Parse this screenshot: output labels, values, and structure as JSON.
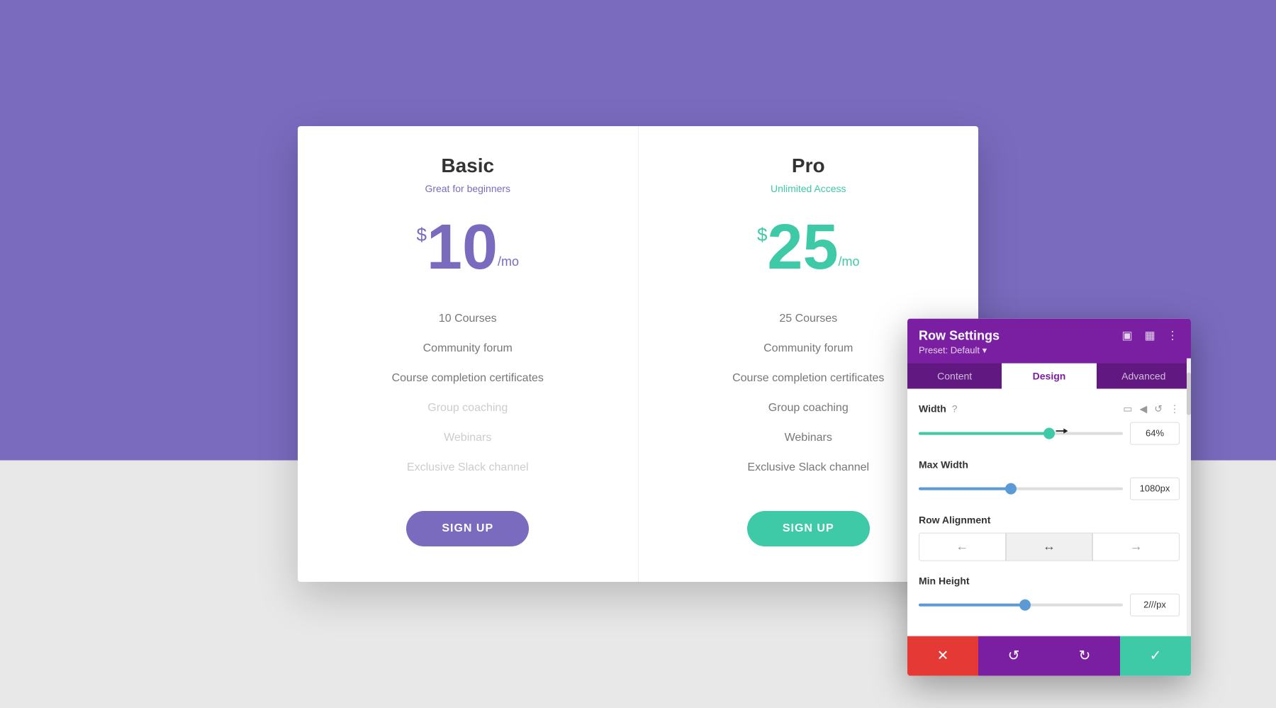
{
  "background": {
    "top_color": "#7b6bbf",
    "bottom_color": "#e8e8e8"
  },
  "pricing": {
    "basic": {
      "name": "Basic",
      "tagline": "Great for beginners",
      "currency": "$",
      "amount": "10",
      "period": "/mo",
      "features": [
        {
          "label": "10 Courses",
          "disabled": false
        },
        {
          "label": "Community forum",
          "disabled": false
        },
        {
          "label": "Course completion certificates",
          "disabled": false
        },
        {
          "label": "Group coaching",
          "disabled": true
        },
        {
          "label": "Webinars",
          "disabled": true
        },
        {
          "label": "Exclusive Slack channel",
          "disabled": true
        }
      ],
      "cta": "SIGN UP"
    },
    "pro": {
      "name": "Pro",
      "tagline": "Unlimited Access",
      "currency": "$",
      "amount": "25",
      "period": "/mo",
      "features": [
        {
          "label": "25 Courses",
          "disabled": false
        },
        {
          "label": "Community forum",
          "disabled": false
        },
        {
          "label": "Course completion certificates",
          "disabled": false
        },
        {
          "label": "Group coaching",
          "disabled": false
        },
        {
          "label": "Webinars",
          "disabled": false
        },
        {
          "label": "Exclusive Slack channel",
          "disabled": false
        }
      ],
      "cta": "SIGN UP"
    }
  },
  "panel": {
    "title": "Row Settings",
    "preset_label": "Preset: Default ▾",
    "tabs": [
      {
        "label": "Content",
        "active": false
      },
      {
        "label": "Design",
        "active": true
      },
      {
        "label": "Advanced",
        "active": false
      }
    ],
    "width": {
      "label": "Width",
      "value": "64%",
      "fill_percent": 64
    },
    "max_width": {
      "label": "Max Width",
      "value": "1080px",
      "fill_percent": 45
    },
    "row_alignment": {
      "label": "Row Alignment",
      "options": [
        "←",
        "↔",
        "→"
      ],
      "active_index": 1
    },
    "min_height": {
      "label": "Min Height",
      "value": "2///px",
      "fill_percent": 52
    },
    "actions": {
      "cancel_icon": "✕",
      "undo_icon": "↺",
      "redo_icon": "↻",
      "confirm_icon": "✓"
    }
  }
}
